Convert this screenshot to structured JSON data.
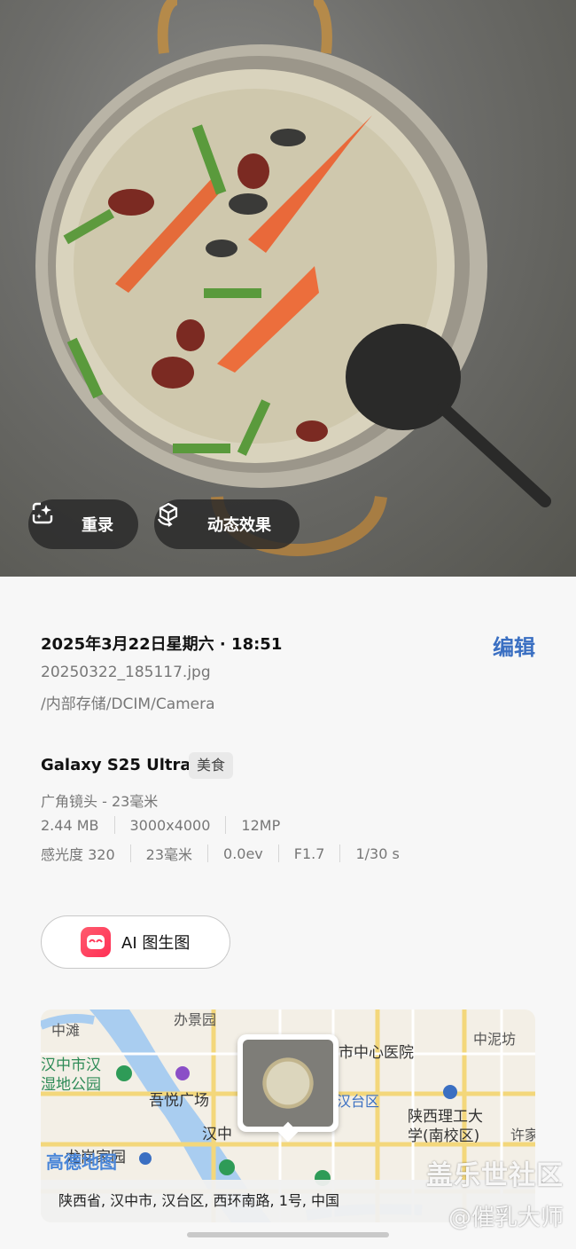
{
  "photo": {
    "chips": {
      "redo": "重录",
      "motion": "动态效果"
    }
  },
  "details": {
    "datetime": "2025年3月22日星期六 · 18:51",
    "edit_label": "编辑",
    "filename": "20250322_185117.jpg",
    "path": "/内部存储/DCIM/Camera",
    "device": "Galaxy S25 Ultra",
    "tag": "美食",
    "lens": "广角镜头 - 23毫米",
    "specs1": [
      "2.44 MB",
      "3000x4000",
      "12MP"
    ],
    "specs2": [
      "感光度 320",
      "23毫米",
      "0.0ev",
      "F1.7",
      "1/30 s"
    ]
  },
  "ai_button": {
    "label": "AI 图生图"
  },
  "map": {
    "labels": {
      "banjing": "办景园",
      "zhongtan": "中滩",
      "zhongnifang": "中泥坊",
      "wetland": "汉中市汉\n湿地公园",
      "hospital": "市中心医院",
      "wuyue": "吾悦广场",
      "hantai": "汉台区",
      "university": "陕西理工大\n学(南校区)",
      "xujia": "许家",
      "hanzhong_partial": "汉中",
      "longgang": "龙岗家园",
      "amap": "高德地图"
    },
    "address": "陕西省, 汉中市, 汉台区, 西环南路, 1号, 中国"
  },
  "watermark": {
    "line1": "盖乐世社区",
    "line2": "@催乳大师"
  }
}
